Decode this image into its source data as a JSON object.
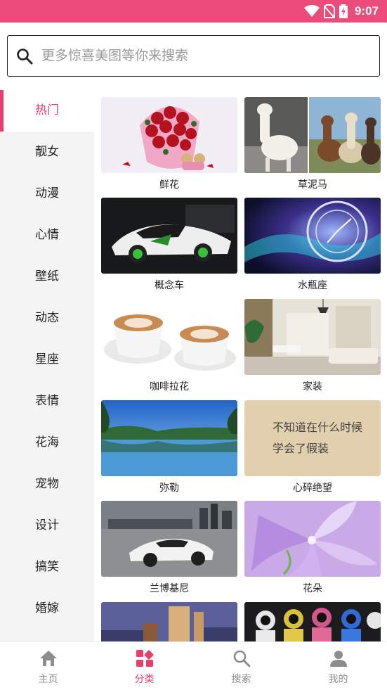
{
  "status_bar": {
    "time": "9:07"
  },
  "search": {
    "placeholder": "更多惊喜美图等你来搜索"
  },
  "sidebar": {
    "active_color": "#e83e6e",
    "items": [
      {
        "label": "热门",
        "active": true
      },
      {
        "label": "靓女"
      },
      {
        "label": "动漫"
      },
      {
        "label": "心情"
      },
      {
        "label": "壁纸"
      },
      {
        "label": "动态"
      },
      {
        "label": "星座"
      },
      {
        "label": "表情"
      },
      {
        "label": "花海"
      },
      {
        "label": "宠物"
      },
      {
        "label": "设计"
      },
      {
        "label": "搞笑"
      },
      {
        "label": "婚嫁"
      }
    ]
  },
  "grid": {
    "items": [
      {
        "caption": "鲜花"
      },
      {
        "caption": "草泥马"
      },
      {
        "caption": "概念车"
      },
      {
        "caption": "水瓶座"
      },
      {
        "caption": "咖啡拉花"
      },
      {
        "caption": "家装"
      },
      {
        "caption": "弥勒"
      },
      {
        "caption": "心碎绝望"
      },
      {
        "caption": "兰博基尼"
      },
      {
        "caption": "花朵"
      }
    ],
    "handwriting_line1": "不知道在什么时候",
    "handwriting_line2": "学会了假装"
  },
  "tabbar": {
    "tabs": [
      {
        "label": "主页",
        "icon": "home-icon"
      },
      {
        "label": "分类",
        "icon": "category-icon",
        "active": true
      },
      {
        "label": "搜索",
        "icon": "search-icon"
      },
      {
        "label": "我的",
        "icon": "user-icon"
      }
    ]
  },
  "colors": {
    "brand": "#ec4c7c",
    "accent": "#e83e6e"
  }
}
